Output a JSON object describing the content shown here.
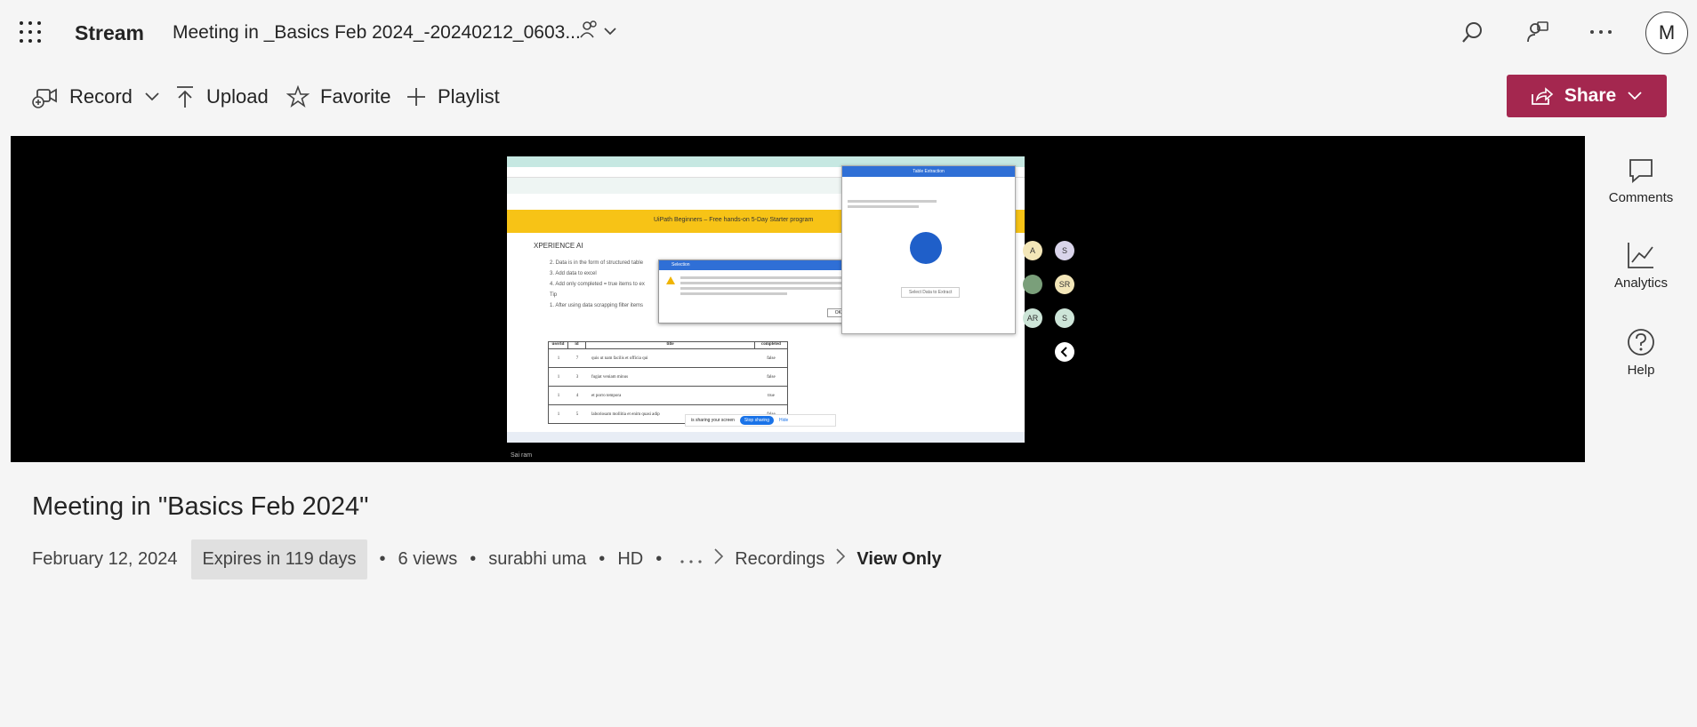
{
  "header": {
    "app_name": "Stream",
    "doc_title": "Meeting in _Basics Feb 2024_-20240212_0603...",
    "avatar_initial": "M"
  },
  "toolbar": {
    "record_label": "Record",
    "upload_label": "Upload",
    "favorite_label": "Favorite",
    "playlist_label": "Playlist",
    "share_label": "Share"
  },
  "rail": {
    "comments_label": "Comments",
    "analytics_label": "Analytics",
    "help_label": "Help"
  },
  "video": {
    "title": "Meeting in \"Basics Feb 2024\"",
    "date": "February 12, 2024",
    "expires": "Expires in 119 days",
    "views": "6 views",
    "owner": "surabhi uma",
    "quality": "HD",
    "breadcrumb_folder": "Recordings",
    "permission": "View Only",
    "presenter_caption": "Sai ram"
  },
  "screen_share": {
    "banner_text": "UiPath Beginners – Free hands-on 5-Day Starter program",
    "header_text": "XPERIENCE AI",
    "list_items": [
      "2. Data is in the form of structured table",
      "3. Add data to excel",
      "4. Add only completed = true items to ex",
      "Tip",
      "1. After using data scrapping filter items"
    ],
    "dialog_title": "Selection",
    "dialog_ok": "OK",
    "table_headers": [
      "userId",
      "id",
      "title",
      "completed"
    ],
    "table_rows": [
      [
        "1",
        "7",
        "quis ut nam facilis et officia qui",
        "false"
      ],
      [
        "1",
        "3",
        "fugiat veniam minus",
        "false"
      ],
      [
        "1",
        "4",
        "et porro tempora",
        "true"
      ],
      [
        "1",
        "5",
        "laboriosam mollitia et enim quasi adip",
        "false"
      ]
    ],
    "sharing_text": "is sharing your screen",
    "stop_sharing": "Stop sharing",
    "hide": "Hide",
    "side_panel_title": "Table Extraction",
    "side_panel_button": "Select Data to Extract"
  },
  "participants": [
    {
      "initials": "A",
      "color": "#f3e6b8"
    },
    {
      "initials": "S",
      "color": "#d9d4ea"
    },
    {
      "initials": "",
      "color": "#7a9f7a"
    },
    {
      "initials": "SR",
      "color": "#f3e6b8"
    },
    {
      "initials": "AR",
      "color": "#cde5d8"
    },
    {
      "initials": "S",
      "color": "#cde5d8"
    }
  ],
  "colors": {
    "share_button": "#a4274f",
    "background": "#f5f5f5"
  }
}
